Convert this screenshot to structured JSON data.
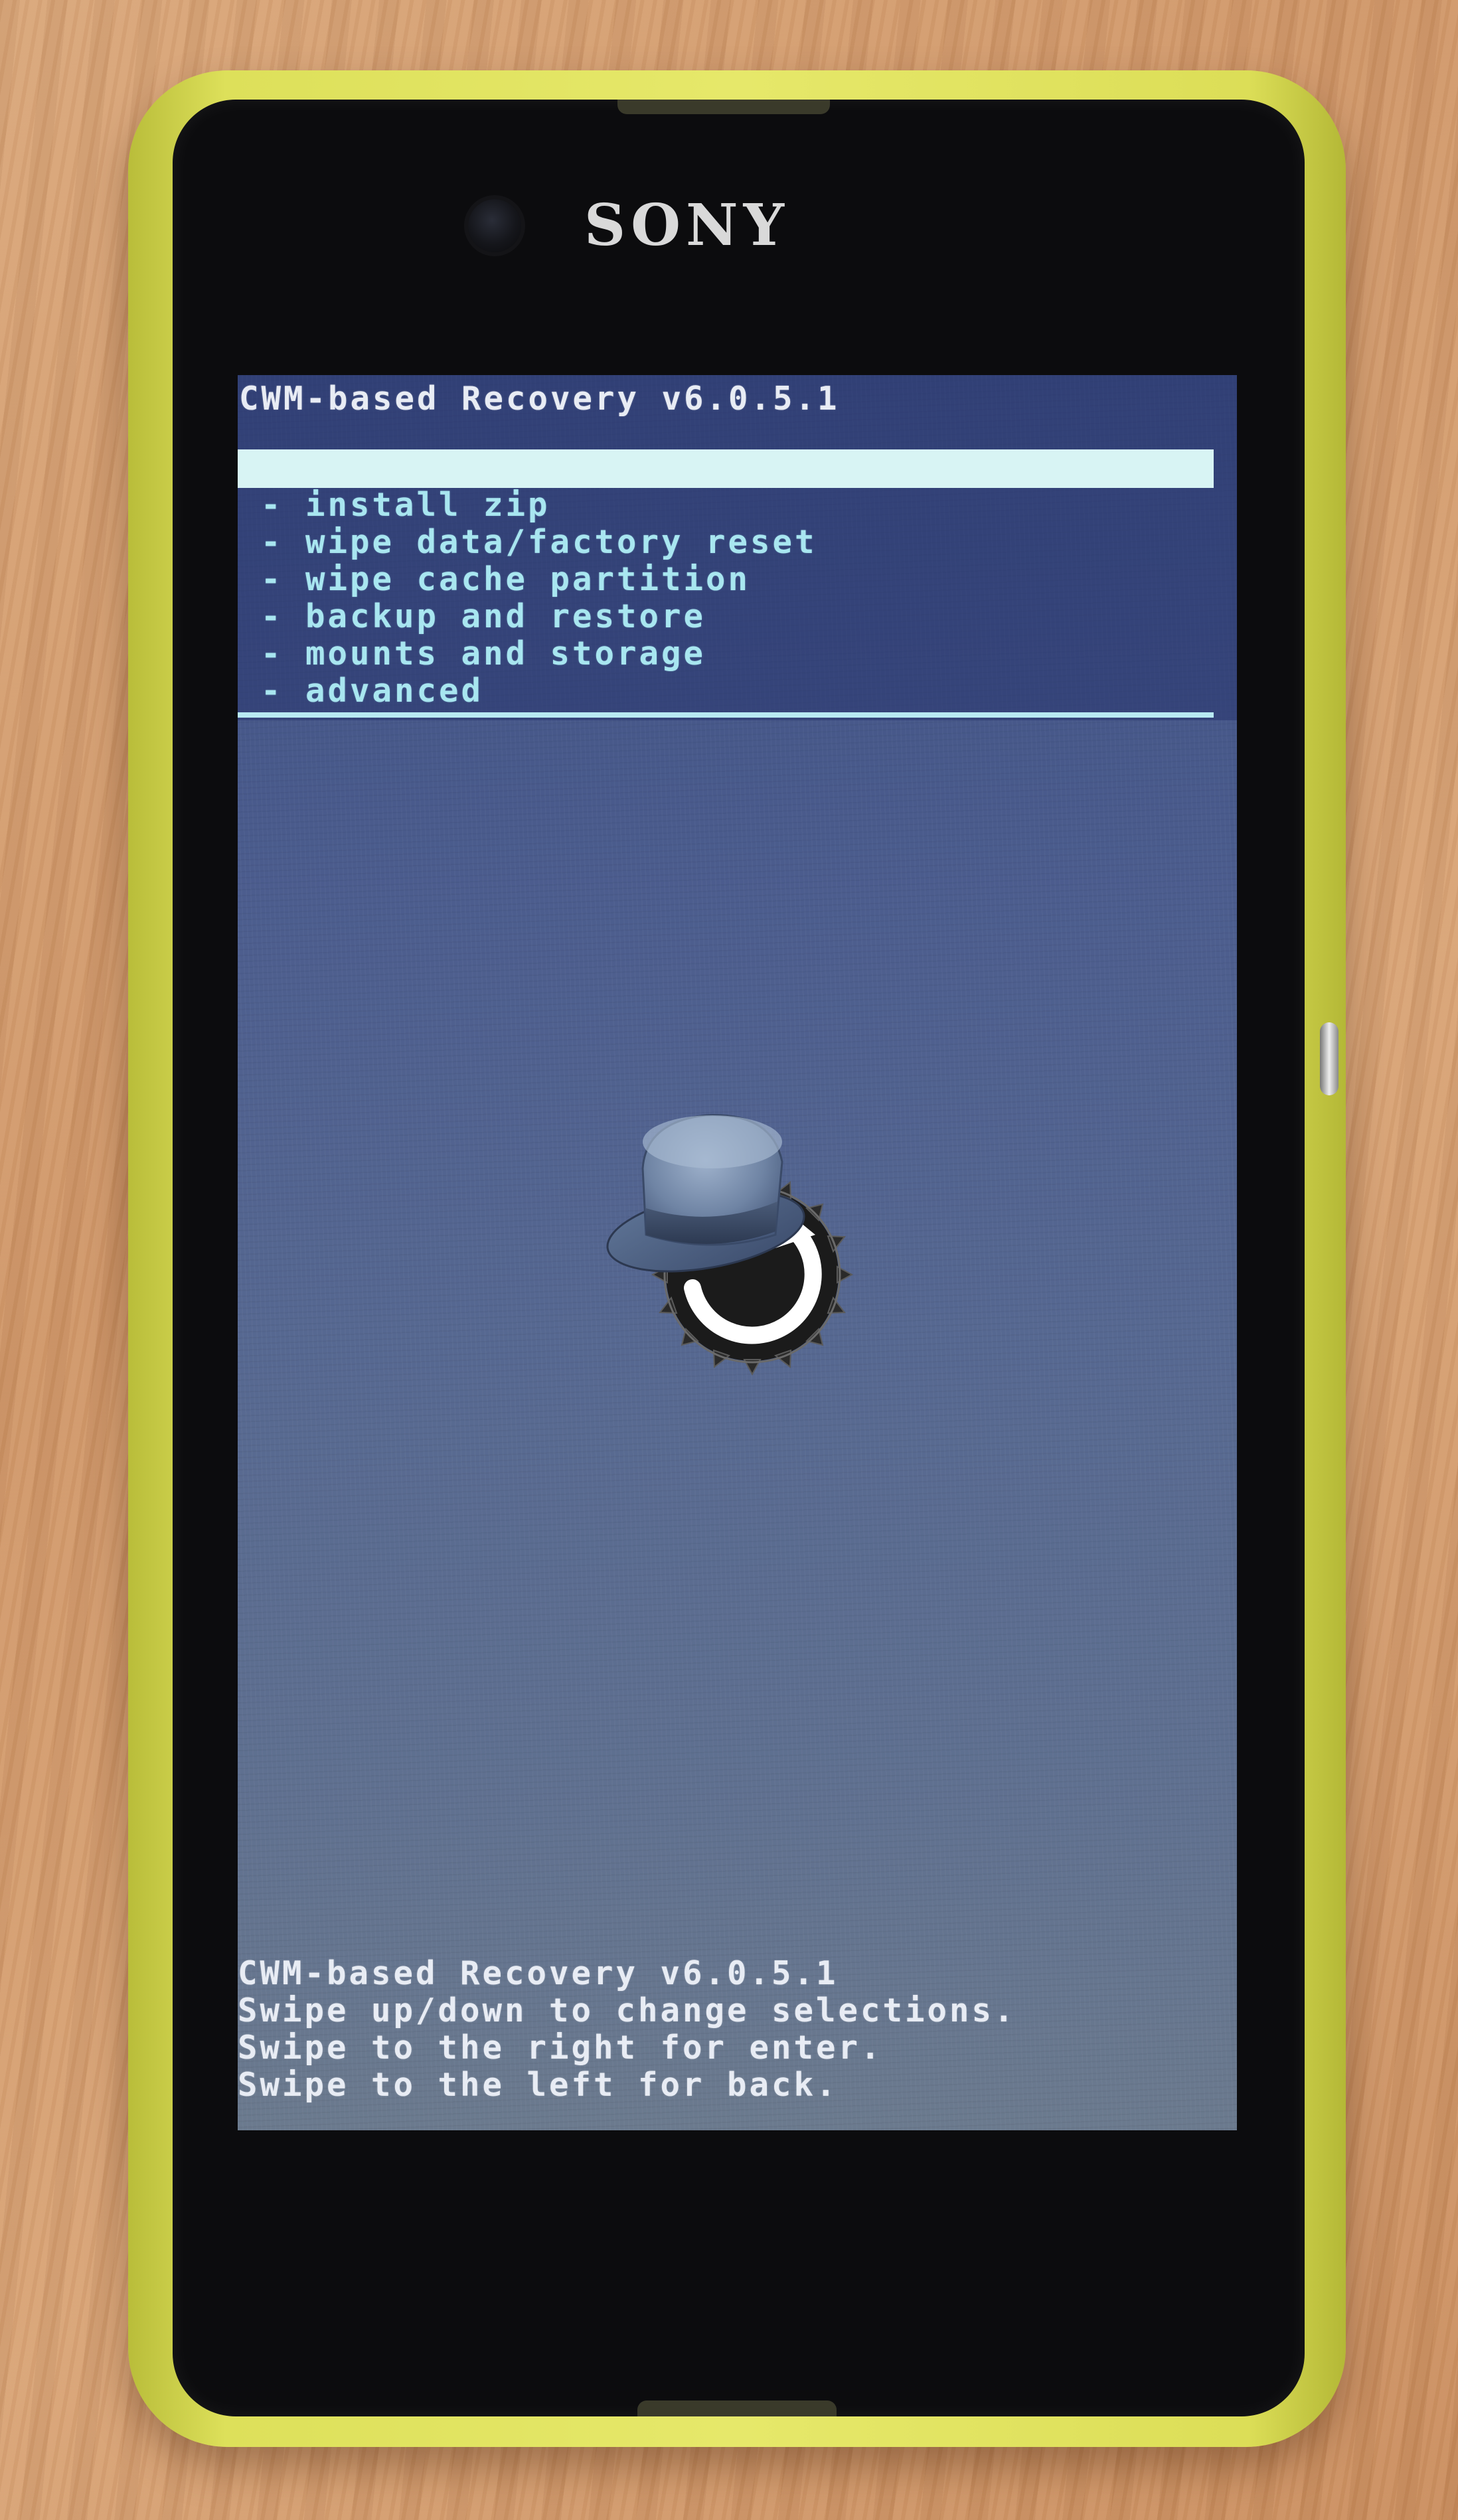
{
  "device": {
    "brand": "SONY"
  },
  "recovery": {
    "title": "CWM-based Recovery v6.0.5.1",
    "menu_items": [
      "- install zip",
      "- wipe data/factory reset",
      "- wipe cache partition",
      "- backup and restore",
      "- mounts and storage",
      "- advanced"
    ],
    "footer_lines": [
      "CWM-based Recovery v6.0.5.1",
      "Swipe up/down to change selections.",
      "Swipe to the right for enter.",
      "Swipe to the left for back."
    ]
  },
  "colors": {
    "case": "#e6e86a",
    "screen_bg": "#4c5d8e",
    "menu_text": "#a8e6f0",
    "highlight": "#d8f4f4"
  },
  "icons": {
    "logo": "clockworkmod-hat-gear-icon"
  }
}
